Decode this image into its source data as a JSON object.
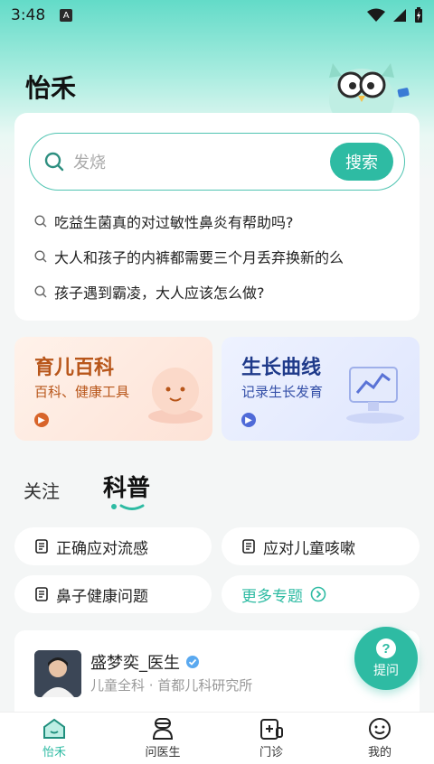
{
  "status": {
    "time": "3:48",
    "notif": "A"
  },
  "app": {
    "title": "怡禾"
  },
  "search": {
    "placeholder": "发烧",
    "button": "搜索",
    "suggestions": [
      "吃益生菌真的对过敏性鼻炎有帮助吗?",
      "大人和孩子的内裤都需要三个月丢弃换新的么",
      "孩子遇到霸凌，大人应该怎么做?"
    ]
  },
  "features": [
    {
      "title": "育儿百科",
      "subtitle": "百科、健康工具",
      "title_color": "#b8561a",
      "sub_color": "#b8561a",
      "arrow_color": "#d8642a"
    },
    {
      "title": "生长曲线",
      "subtitle": "记录生长发育",
      "title_color": "#1f3a8a",
      "sub_color": "#3550a8",
      "arrow_color": "#4f6ad8"
    }
  ],
  "tabs": {
    "follow": "关注",
    "science": "科普"
  },
  "topics": [
    "正确应对流感",
    "应对儿童咳嗽",
    "鼻子健康问题",
    "更多专题"
  ],
  "doctor": {
    "name": "盛梦奕_医生",
    "dept": "儿童全科 · 首都儿科研究所"
  },
  "fab": {
    "label": "提问"
  },
  "nav": [
    {
      "label": "怡禾",
      "icon": "home-icon"
    },
    {
      "label": "问医生",
      "icon": "doctor-icon"
    },
    {
      "label": "门诊",
      "icon": "clinic-icon"
    },
    {
      "label": "我的",
      "icon": "profile-icon"
    }
  ],
  "colors": {
    "accent": "#2ebba3"
  }
}
